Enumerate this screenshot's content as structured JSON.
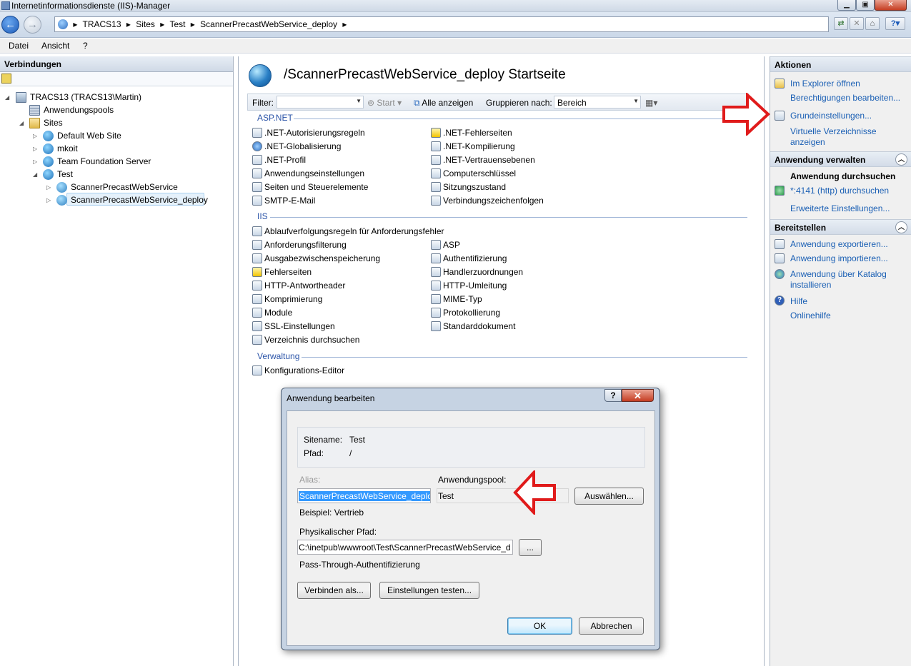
{
  "window": {
    "title": "Internetinformationsdienste (IIS)-Manager"
  },
  "nav": {
    "breadcrumb": [
      "TRACS13",
      "Sites",
      "Test",
      "ScannerPrecastWebService_deploy"
    ]
  },
  "menu": [
    "Datei",
    "Ansicht",
    "?"
  ],
  "connections": {
    "header": "Verbindungen",
    "tree": [
      {
        "label": "TRACS13 (TRACS13\\Martin)",
        "icon": "server-icon"
      },
      {
        "label": "Anwendungspools",
        "icon": "app-pools-icon"
      },
      {
        "label": "Sites",
        "icon": "sites-folder-icon"
      },
      {
        "label": "Default Web Site",
        "icon": "globe-icon"
      },
      {
        "label": "mkoit",
        "icon": "globe-icon"
      },
      {
        "label": "Team Foundation Server",
        "icon": "globe-icon"
      },
      {
        "label": "Test",
        "icon": "globe-icon"
      },
      {
        "label": "ScannerPrecastWebService",
        "icon": "web-app-icon"
      },
      {
        "label": "ScannerPrecastWebService_deploy",
        "icon": "web-app-icon"
      }
    ]
  },
  "main": {
    "title": "/ScannerPrecastWebService_deploy Startseite",
    "filter": {
      "label": "Filter:",
      "start": "Start",
      "show_all": "Alle anzeigen",
      "group_label": "Gruppieren nach:",
      "group_value": "Bereich"
    },
    "sections": [
      {
        "name": "ASP.NET",
        "left": [
          ".NET-Autorisierungsregeln",
          ".NET-Globalisierung",
          ".NET-Profil",
          "Anwendungseinstellungen",
          "Seiten und Steuerelemente",
          "SMTP-E-Mail"
        ],
        "right": [
          ".NET-Fehlerseiten",
          ".NET-Kompilierung",
          ".NET-Vertrauensebenen",
          "Computerschlüssel",
          "Sitzungszustand",
          "Verbindungszeichenfolgen"
        ]
      },
      {
        "name": "IIS",
        "full": "Ablaufverfolgungsregeln für Anforderungsfehler",
        "left": [
          "Anforderungsfilterung",
          "Ausgabezwischenspeicherung",
          "Fehlerseiten",
          "HTTP-Antwortheader",
          "Komprimierung",
          "Module",
          "SSL-Einstellungen",
          "Verzeichnis durchsuchen"
        ],
        "right": [
          "ASP",
          "Authentifizierung",
          "Handlerzuordnungen",
          "HTTP-Umleitung",
          "MIME-Typ",
          "Protokollierung",
          "Standarddokument"
        ]
      },
      {
        "name": "Verwaltung",
        "left": [
          "Konfigurations-Editor"
        ]
      }
    ]
  },
  "actions": {
    "header": "Aktionen",
    "top": [
      "Im Explorer öffnen",
      "Berechtigungen bearbeiten...",
      "Grundeinstellungen...",
      "Virtuelle Verzeichnisse",
      "anzeigen"
    ],
    "manage_header": "Anwendung verwalten",
    "browse_header": "Anwendung durchsuchen",
    "browse_link": "*:4141 (http) durchsuchen",
    "advanced": "Erweiterte Einstellungen...",
    "deploy_header": "Bereitstellen",
    "deploy": [
      "Anwendung exportieren...",
      "Anwendung importieren...",
      "Anwendung über Katalog",
      "installieren"
    ],
    "help": "Hilfe",
    "online_help": "Onlinehilfe"
  },
  "dialog": {
    "title": "Anwendung bearbeiten",
    "help_btn": "?",
    "sitename_label": "Sitename:",
    "sitename": "Test",
    "path_label": "Pfad:",
    "path": "/",
    "alias_label": "Alias:",
    "alias": "ScannerPrecastWebService_deploy",
    "pool_label": "Anwendungspool:",
    "pool": "Test",
    "select_btn": "Auswählen...",
    "example": "Beispiel: Vertrieb",
    "phys_label": "Physikalischer Pfad:",
    "phys": "C:\\inetpub\\wwwroot\\Test\\ScannerPrecastWebService_d",
    "browse_btn": "...",
    "passthrough": "Pass-Through-Authentifizierung",
    "connect_btn": "Verbinden als...",
    "test_btn": "Einstellungen testen...",
    "ok": "OK",
    "cancel": "Abbrechen"
  },
  "colors": {
    "link": "#1a5fb4",
    "section": "#2b54a8",
    "arrow": "#e01b1b",
    "selection": "#3399ff"
  }
}
